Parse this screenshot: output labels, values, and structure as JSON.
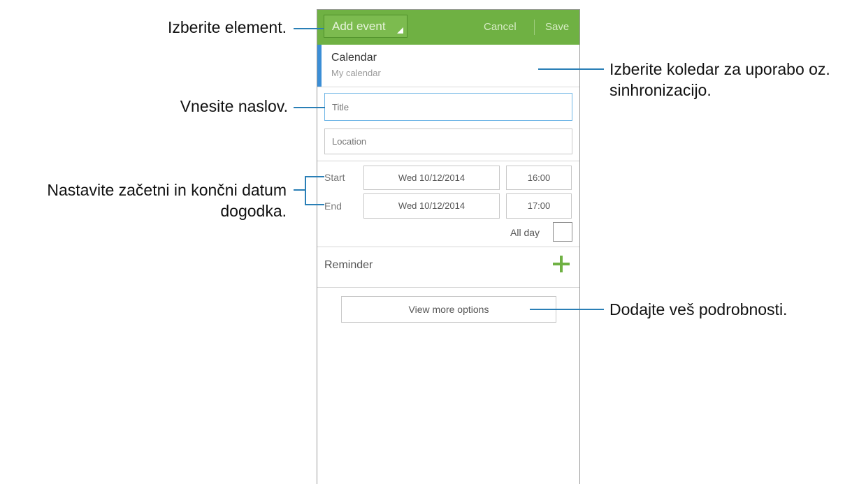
{
  "actionbar": {
    "add_event_label": "Add event",
    "cancel_label": "Cancel",
    "save_label": "Save",
    "accent_color": "#6fb143"
  },
  "calendar": {
    "title": "Calendar",
    "subtitle": "My calendar"
  },
  "fields": {
    "title_placeholder": "Title",
    "location_placeholder": "Location"
  },
  "schedule": {
    "start_label": "Start",
    "end_label": "End",
    "start_date": "Wed 10/12/2014",
    "start_time": "16:00",
    "end_date": "Wed 10/12/2014",
    "end_time": "17:00",
    "all_day_label": "All day",
    "all_day_checked": false
  },
  "reminder": {
    "label": "Reminder",
    "add_icon": "plus-icon"
  },
  "more_options_label": "View more options",
  "callouts": {
    "select_item": "Izberite element.",
    "select_calendar_line1": "Izberite koledar za uporabo oz.",
    "select_calendar_line2": "sinhronizacijo.",
    "enter_title": "Vnesite naslov.",
    "set_dates_line1": "Nastavite začetni in končni datum",
    "set_dates_line2": "dogodka.",
    "add_details": "Dodajte veš podrobnosti."
  }
}
